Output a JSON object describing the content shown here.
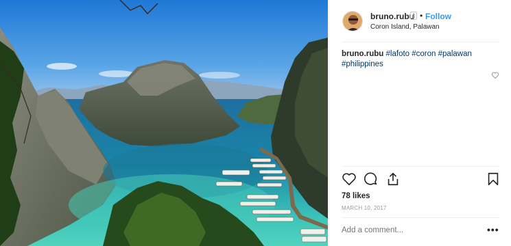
{
  "post": {
    "username": "bruno.rubu",
    "follow_separator": "•",
    "follow_label": "Follow",
    "location": "Coron Island, Palawan",
    "caption": {
      "username": "bruno.rubu",
      "hashtags": [
        "#lafoto",
        "#coron",
        "#palawan",
        "#philippines"
      ]
    },
    "likes": "78 likes",
    "date": "MARCH 10, 2017",
    "comment_placeholder": "Add a comment...",
    "more_label": "•••"
  },
  "icons": {
    "caption_like": "heart-outline-icon",
    "like": "heart-outline-icon",
    "comment": "speech-bubble-icon",
    "share": "share-icon",
    "save": "bookmark-icon",
    "verified": "sort-arrows-icon"
  },
  "colors": {
    "link": "#3897f0",
    "hashtag": "#003569",
    "muted": "#999999",
    "text": "#262626",
    "divider": "#efefef"
  }
}
